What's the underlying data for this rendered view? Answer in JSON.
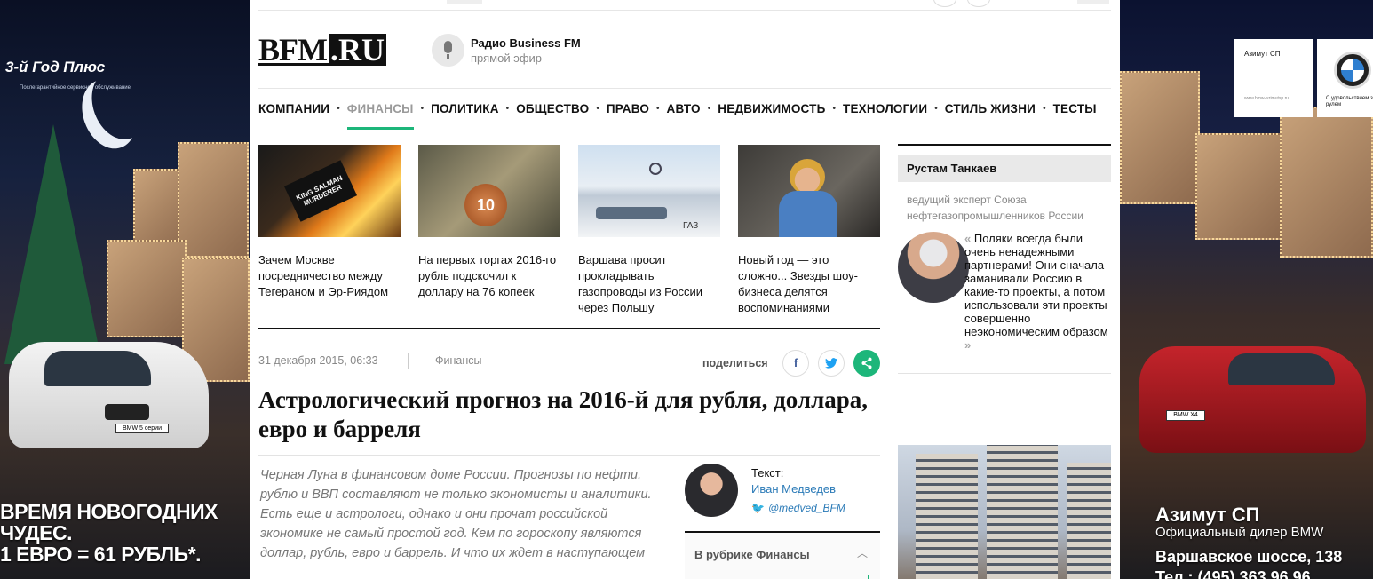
{
  "left_ad": {
    "brand": "3-й Год Плюс",
    "brand_sub": "Послегарантийное сервисное обслуживание",
    "headline_1": "ВРЕМЯ НОВОГОДНИХ",
    "headline_2": "ЧУДЕС.",
    "headline_3": "1 ЕВРО = 61 РУБЛЬ*.",
    "car_plate": "BMW 5 серии"
  },
  "right_ad": {
    "card_title": "Азимут СП",
    "card_site": "www.bmw-azimutsp.ru",
    "card_slogan": "С удовольствием за рулем",
    "brand": "Азимут СП",
    "dealer": "Официальный дилер BMW",
    "address": "Варшавское шоссе, 138",
    "phone": "Тел.: (495) 363 96 96",
    "car_plate": "BMW X4"
  },
  "header": {
    "logo_word": "BFM",
    "logo_box": ".RU",
    "radio_title": "Радио Business FM",
    "radio_sub": "прямой эфир"
  },
  "nav": [
    {
      "label": "КОМПАНИИ",
      "active": false
    },
    {
      "label": "ФИНАНСЫ",
      "active": true
    },
    {
      "label": "ПОЛИТИКА",
      "active": false
    },
    {
      "label": "ОБЩЕСТВО",
      "active": false
    },
    {
      "label": "ПРАВО",
      "active": false
    },
    {
      "label": "АВТО",
      "active": false
    },
    {
      "label": "НЕДВИЖИМОСТЬ",
      "active": false
    },
    {
      "label": "ТЕХНОЛОГИИ",
      "active": false
    },
    {
      "label": "СТИЛЬ ЖИЗНИ",
      "active": false
    },
    {
      "label": "ТЕСТЫ",
      "active": false
    }
  ],
  "teasers": [
    {
      "title": "Зачем Москве посредничество между Тегераном и Эр-Риядом",
      "img_text": "KING SALMAN MURDERER"
    },
    {
      "title": "На первых торгах 2016-го рубль подскочил к доллару на 76 копеек",
      "img_text": "10"
    },
    {
      "title": "Варшава просит прокладывать газопроводы из России через Польшу",
      "img_text": "ГАЗ"
    },
    {
      "title": "Новый год — это сложно... Звезды шоу-бизнеса делятся воспоминаниями",
      "img_text": ""
    }
  ],
  "article": {
    "date": "31 декабря 2015, 06:33",
    "rubric": "Финансы",
    "share_label": "поделиться",
    "title": "Астрологический прогноз на 2016-й для рубля, доллара, евро и барреля",
    "lead": "Черная Луна в финансовом доме России. Прогнозы по нефти, рублю и ВВП составляют не только экономисты и аналитики. Есть еще и астрологи, однако и они прочат российской экономике не самый простой год. Кем по гороскопу являются доллар, рубль, евро и баррель. И что их ждет в наступающем",
    "author_label": "Текст:",
    "author_name": "Иван Медведев",
    "author_twitter": "@medved_BFM",
    "rubric_box": "В рубрике Финансы"
  },
  "sidebar": {
    "name": "Рустам Танкаев",
    "role": "ведущий эксперт Союза нефтегазопромышленников России",
    "quote": "Поляки всегда были очень ненадежными партнерами! Они сначала заманивали Россию в какие-то проекты, а потом использовали эти проекты совершенно неэкономическим образом"
  },
  "colors": {
    "accent": "#1db67a",
    "link": "#2a7ab7",
    "facebook": "#3b5998",
    "twitter": "#1da1f2"
  }
}
